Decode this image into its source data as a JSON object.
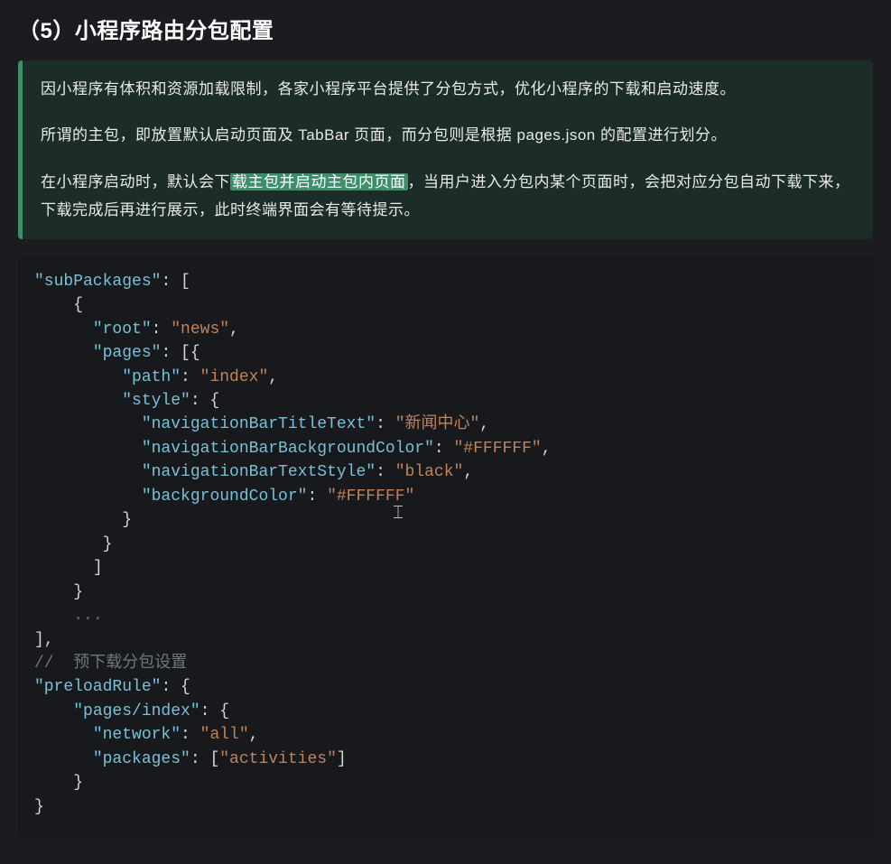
{
  "heading": "（5）小程序路由分包配置",
  "quote": {
    "p1": "因小程序有体积和资源加载限制，各家小程序平台提供了分包方式，优化小程序的下载和启动速度。",
    "p2": "所谓的主包，即放置默认启动页面及 TabBar 页面，而分包则是根据 pages.json 的配置进行划分。",
    "p3_before": "在小程序启动时，默认会下",
    "p3_hl": "载主包并启动主包内页面",
    "p3_after": "，当用户进入分包内某个页面时，会把对应分包自动下载下来，下载完成后再进行展示，此时终端界面会有等待提示。"
  },
  "code": {
    "k_subPackages": "\"subPackages\"",
    "k_root": "\"root\"",
    "v_news": "\"news\"",
    "k_pages": "\"pages\"",
    "k_path": "\"path\"",
    "v_index": "\"index\"",
    "k_style": "\"style\"",
    "k_navTitle": "\"navigationBarTitleText\"",
    "v_newsCenter": "\"新闻中心\"",
    "k_navBg": "\"navigationBarBackgroundColor\"",
    "v_fff1": "\"#FFFFFF\"",
    "k_navText": "\"navigationBarTextStyle\"",
    "v_black": "\"black\"",
    "k_bgColor": "\"backgroundColor\"",
    "v_fff2": "\"#FFFFFF\"",
    "ellipsis": "...",
    "comment_preload": "//  预下载分包设置",
    "k_preloadRule": "\"preloadRule\"",
    "k_pagesIndex": "\"pages/index\"",
    "k_network": "\"network\"",
    "v_all": "\"all\"",
    "k_packages": "\"packages\"",
    "v_activities": "\"activities\""
  }
}
